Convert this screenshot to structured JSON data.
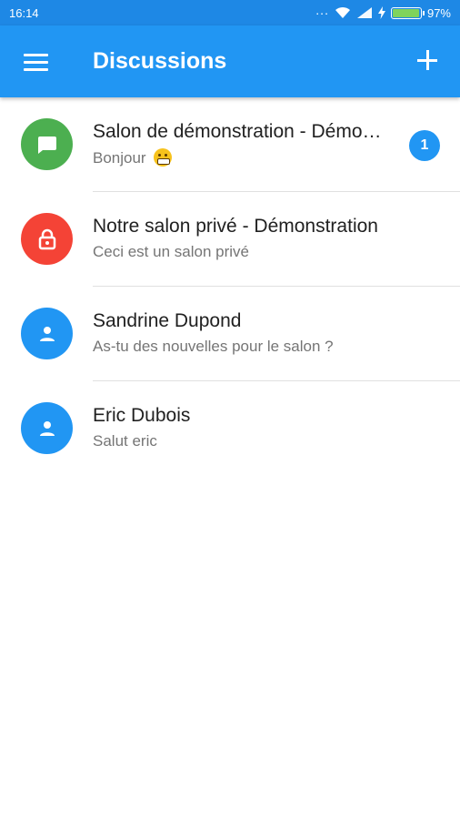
{
  "status_bar": {
    "time": "16:14",
    "battery_text": "97%",
    "battery_level": 0.97,
    "dots": "..."
  },
  "app_bar": {
    "title": "Discussions",
    "menu_icon": "menu-icon",
    "add_icon": "add-icon"
  },
  "colors": {
    "primary": "#2196f3",
    "status_bar": "#1e88e5",
    "green": "#4caf50",
    "red": "#f44336",
    "blue": "#2196f3"
  },
  "discussions": [
    {
      "title": "Salon de démonstration - Démonstration",
      "subtitle": "Bonjour",
      "emoji": "grinning-face",
      "icon": "chat-bubble-icon",
      "avatar_color": "#4caf50",
      "badge": "1"
    },
    {
      "title": "Notre salon privé - Démonstration",
      "subtitle": "Ceci est un salon privé",
      "icon": "lock-icon",
      "avatar_color": "#f44336"
    },
    {
      "title": "Sandrine Dupond",
      "subtitle": "As-tu des nouvelles pour le salon ?",
      "icon": "person-icon",
      "avatar_color": "#2196f3"
    },
    {
      "title": "Eric Dubois",
      "subtitle": "Salut eric",
      "icon": "person-icon",
      "avatar_color": "#2196f3"
    }
  ]
}
